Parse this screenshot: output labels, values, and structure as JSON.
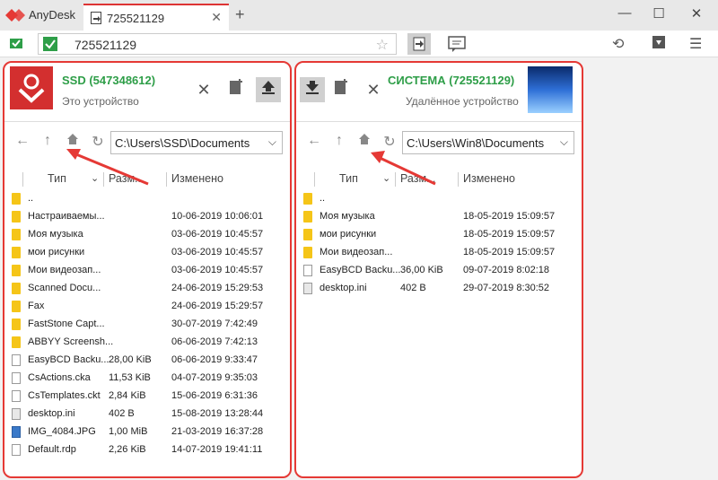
{
  "app": {
    "name": "AnyDesk",
    "tab_label": "725521129",
    "new_tab": "+"
  },
  "window": {
    "minimize": "—",
    "maximize": "☐",
    "close": "✕"
  },
  "address": {
    "value": "725521129",
    "star": "☆"
  },
  "icons": {
    "history": "history-icon",
    "download": "download-icon",
    "menu": "menu-icon"
  },
  "left_panel": {
    "name": "SSD (547348612)",
    "subtitle": "Это устройство",
    "path": "C:\\Users\\SSD\\Documents",
    "headers": {
      "type": "Тип",
      "size": "Разм...",
      "modified": "Изменено"
    },
    "rows": [
      {
        "icon": "folder",
        "name": "..",
        "size": "",
        "date": ""
      },
      {
        "icon": "folder",
        "name": "Настраиваемы...",
        "size": "",
        "date": "10-06-2019 10:06:01"
      },
      {
        "icon": "folder",
        "name": "Моя музыка",
        "size": "",
        "date": "03-06-2019 10:45:57"
      },
      {
        "icon": "folder",
        "name": "мои рисунки",
        "size": "",
        "date": "03-06-2019 10:45:57"
      },
      {
        "icon": "folder",
        "name": "Мои видеозап...",
        "size": "",
        "date": "03-06-2019 10:45:57"
      },
      {
        "icon": "folder",
        "name": "Scanned Docu...",
        "size": "",
        "date": "24-06-2019 15:29:53"
      },
      {
        "icon": "folder",
        "name": "Fax",
        "size": "",
        "date": "24-06-2019 15:29:57"
      },
      {
        "icon": "folder",
        "name": "FastStone Capt...",
        "size": "",
        "date": "30-07-2019 7:42:49"
      },
      {
        "icon": "folder",
        "name": "ABBYY Screensh...",
        "size": "",
        "date": "06-06-2019 7:42:13"
      },
      {
        "icon": "file",
        "name": "EasyBCD Backu...",
        "size": "28,00 KiB",
        "date": "06-06-2019 9:33:47"
      },
      {
        "icon": "file",
        "name": "CsActions.cka",
        "size": "11,53 KiB",
        "date": "04-07-2019 9:35:03"
      },
      {
        "icon": "file",
        "name": "CsTemplates.ckt",
        "size": "2,84 KiB",
        "date": "15-06-2019 6:31:36"
      },
      {
        "icon": "ini",
        "name": "desktop.ini",
        "size": "402 B",
        "date": "15-08-2019 13:28:44"
      },
      {
        "icon": "img",
        "name": "IMG_4084.JPG",
        "size": "1,00 MiB",
        "date": "21-03-2019 16:37:28"
      },
      {
        "icon": "file",
        "name": "Default.rdp",
        "size": "2,26 KiB",
        "date": "14-07-2019 19:41:11"
      }
    ]
  },
  "right_panel": {
    "name": "СИСТЕМА (725521129)",
    "subtitle": "Удалённое устройство",
    "path": "C:\\Users\\Win8\\Documents",
    "headers": {
      "type": "Тип",
      "size": "Разм...",
      "modified": "Изменено"
    },
    "rows": [
      {
        "icon": "folder",
        "name": "..",
        "size": "",
        "date": ""
      },
      {
        "icon": "folder",
        "name": "Моя музыка",
        "size": "",
        "date": "18-05-2019 15:09:57"
      },
      {
        "icon": "folder",
        "name": "мои рисунки",
        "size": "",
        "date": "18-05-2019 15:09:57"
      },
      {
        "icon": "folder",
        "name": "Мои видеозап...",
        "size": "",
        "date": "18-05-2019 15:09:57"
      },
      {
        "icon": "file",
        "name": "EasyBCD Backu...",
        "size": "36,00 KiB",
        "date": "09-07-2019 8:02:18"
      },
      {
        "icon": "ini",
        "name": "desktop.ini",
        "size": "402 B",
        "date": "29-07-2019 8:30:52"
      }
    ]
  },
  "colors": {
    "accent_red": "#e53935",
    "online_green": "#2e9e48",
    "folder_yellow": "#f5c518"
  }
}
